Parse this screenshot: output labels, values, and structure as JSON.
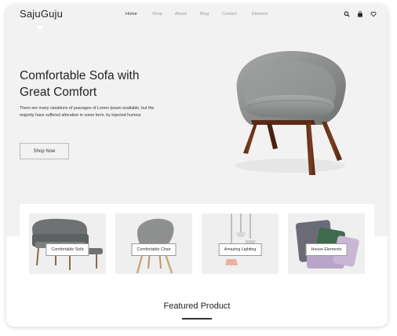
{
  "header": {
    "logo": "SajuGuju",
    "nav": [
      {
        "label": "Home",
        "active": true
      },
      {
        "label": "Shop",
        "active": false
      },
      {
        "label": "About",
        "active": false
      },
      {
        "label": "Blog",
        "active": false
      },
      {
        "label": "Contact",
        "active": false
      },
      {
        "label": "Element",
        "active": false
      }
    ],
    "icons": [
      "search-icon",
      "bag-icon",
      "heart-icon"
    ]
  },
  "hero": {
    "title_line1": "Comfortable Sofa with",
    "title_line2": "Great Comfort",
    "description": "There are many variations of passages of Lorem Ipsum available, but the majority have suffered alteration in some form, by injected humour",
    "button": "Shop Now"
  },
  "categories": [
    {
      "label": "Comfortable Sofa"
    },
    {
      "label": "Comfortable Chair"
    },
    {
      "label": "Amazing Lighting"
    },
    {
      "label": "House Elements"
    }
  ],
  "featured": {
    "title": "Featured Product"
  },
  "colors": {
    "hero_bg": "#f2f2f2",
    "card_bg": "#efefef",
    "text": "#222222",
    "nav_muted": "#999999"
  }
}
